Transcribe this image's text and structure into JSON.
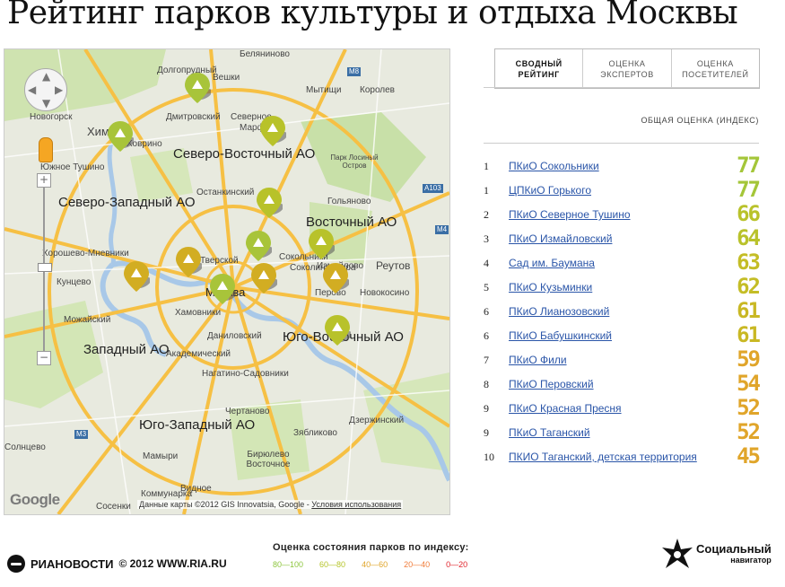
{
  "page": {
    "title": "Рейтинг парков культуры и отдыха Москвы"
  },
  "map": {
    "region_labels": [
      "Северо-Восточный АО",
      "Северо-Западный АО",
      "Восточный АО",
      "Западный АО",
      "Юго-Восточный АО",
      "Юго-Западный АО",
      "Москва"
    ],
    "place_labels": [
      "Долгопрудный",
      "Вешки",
      "Мытищи",
      "Королев",
      "Беляниново",
      "Новогорск",
      "Химки",
      "Ховрино",
      "Дмитровский",
      "Северное",
      "Марфино",
      "Парк Лосиный Остров",
      "Южное Тушино",
      "Останкинский",
      "Гольяново",
      "Хорошево-Мневники",
      "Тверской",
      "Сокольники",
      "Измайлово",
      "Реутов",
      "Кунцево",
      "Соколиная гора",
      "Хамовники",
      "Перово",
      "Новокосино",
      "Можайский",
      "Даниловский",
      "Академический",
      "Нагатино-Садовники",
      "Чертаново",
      "Дзержинский",
      "Зябликово",
      "Бирюлево Восточное",
      "Коммунарка",
      "Мамыри",
      "Видное",
      "Сосенки",
      "Солнцево"
    ],
    "road_badges": [
      "M8",
      "A103",
      "M3",
      "M4"
    ],
    "controls": {
      "zoom_in": "+",
      "zoom_out": "−"
    },
    "google_logo": "Google",
    "attribution": "Данные карты ©2012 GIS Innovatsia, Google",
    "terms_link": "Условия использования"
  },
  "tabs": [
    {
      "label": "СВОДНЫЙ РЕЙТИНГ",
      "active": true
    },
    {
      "label": "ОЦЕНКА ЭКСПЕРТОВ",
      "active": false
    },
    {
      "label": "ОЦЕНКА ПОСЕТИТЕЛЕЙ",
      "active": false
    }
  ],
  "table": {
    "column_header": "ОБЩАЯ ОЦЕНКА (ИНДЕКС)",
    "rows": [
      {
        "rank": "1",
        "name": "ПКиО Сокольники",
        "score": "77",
        "color": "#a4c639"
      },
      {
        "rank": "1",
        "name": "ЦПКиО Горького",
        "score": "77",
        "color": "#a4c639"
      },
      {
        "rank": "2",
        "name": "ПКиО Северное Тушино",
        "score": "66",
        "color": "#b9c22b"
      },
      {
        "rank": "3",
        "name": "ПКиО Измайловский",
        "score": "64",
        "color": "#b9c22b"
      },
      {
        "rank": "4",
        "name": "Сад им. Баумана",
        "score": "63",
        "color": "#c4bd26"
      },
      {
        "rank": "5",
        "name": "ПКиО Кузьминки",
        "score": "62",
        "color": "#c4bd26"
      },
      {
        "rank": "6",
        "name": "ПКиО Лианозовский",
        "score": "61",
        "color": "#c9b824"
      },
      {
        "rank": "6",
        "name": "ПКиО Бабушкинский",
        "score": "61",
        "color": "#c9b824"
      },
      {
        "rank": "7",
        "name": "ПКиО Фили",
        "score": "59",
        "color": "#e0a52a"
      },
      {
        "rank": "8",
        "name": "ПКиО Перовский",
        "score": "54",
        "color": "#e0a52a"
      },
      {
        "rank": "9",
        "name": "ПКиО Красная Пресня",
        "score": "52",
        "color": "#e0a52a"
      },
      {
        "rank": "9",
        "name": "ПКиО Таганский",
        "score": "52",
        "color": "#e0a52a"
      },
      {
        "rank": "10",
        "name": "ПКИО Таганский, детская территория",
        "score": "45",
        "color": "#e0a52a"
      }
    ]
  },
  "legend": {
    "title": "Оценка состояния парков по индексу:",
    "items": [
      {
        "label": "80—100",
        "color": "#8dc63f"
      },
      {
        "label": "60—80",
        "color": "#b5c42a"
      },
      {
        "label": "40—60",
        "color": "#e0a52a"
      },
      {
        "label": "20—40",
        "color": "#f07c3a"
      },
      {
        "label": "0—20",
        "color": "#e0242c"
      }
    ]
  },
  "footer": {
    "ria": "РИАНОВОСТИ",
    "copyright": "© 2012 WWW.RIA.RU",
    "social_line1": "Социальный",
    "social_line2": "навигатор"
  }
}
